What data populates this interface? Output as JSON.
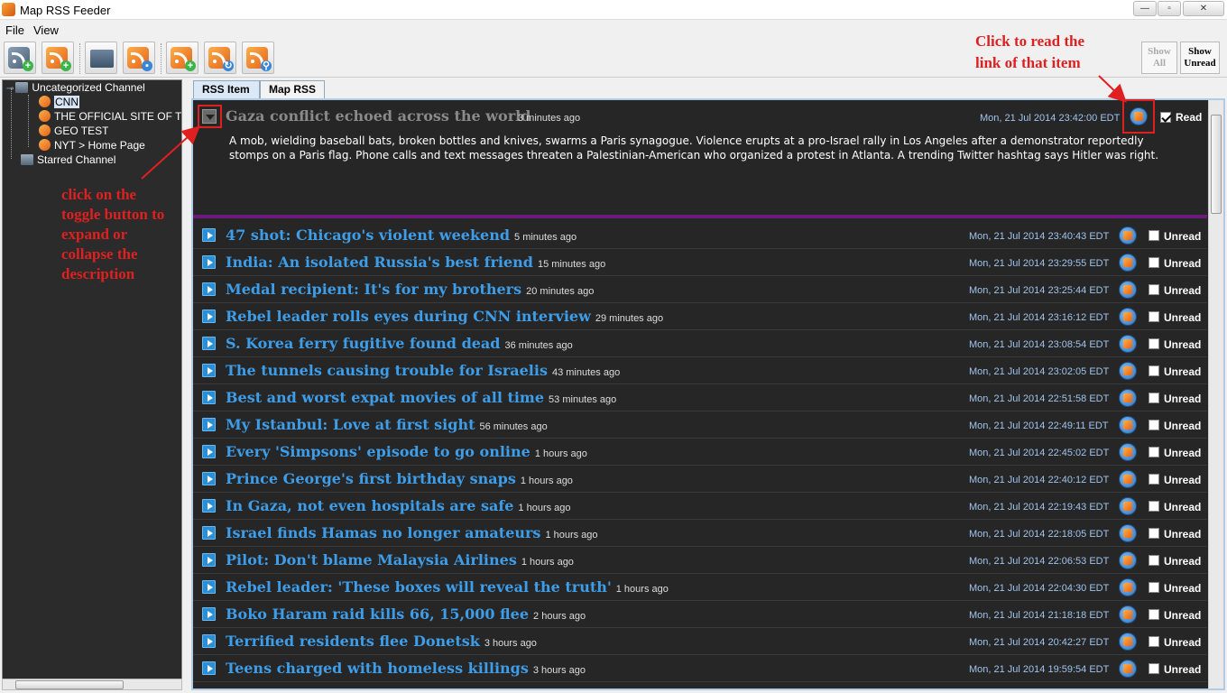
{
  "window": {
    "title": "Map RSS Feeder",
    "minimize": "—",
    "maximize": "▫",
    "close": "✕"
  },
  "menu": [
    "File",
    "View"
  ],
  "toolbar": {
    "show_all_line1": "Show",
    "show_all_line2": "All",
    "show_unread_line1": "Show",
    "show_unread_line2": "Unread"
  },
  "tree": {
    "root": "Uncategorized Channel",
    "items": [
      "CNN",
      "THE OFFICIAL SITE OF T",
      "GEO TEST",
      "NYT > Home Page"
    ],
    "starred": "Starred Channel"
  },
  "tabs": [
    "RSS Item",
    "Map RSS"
  ],
  "expanded": {
    "title": "Gaza conflict echoed across the world",
    "ago": "3 minutes ago",
    "date": "Mon, 21 Jul 2014 23:42:00 EDT",
    "read_label": "Read",
    "description": "A mob, wielding baseball bats, broken bottles and knives, swarms a Paris synagogue. Violence erupts at a pro-Israel rally in Los Angeles after a demonstrator reportedly stomps on a Paris flag. Phone calls and text messages threaten a Palestinian-American who organized a protest in Atlanta. A trending Twitter hashtag says Hitler was right."
  },
  "items": [
    {
      "title": "47 shot: Chicago's violent weekend",
      "ago": "5 minutes ago",
      "date": "Mon, 21 Jul 2014 23:40:43 EDT",
      "status": "Unread"
    },
    {
      "title": "India: An isolated Russia's best friend",
      "ago": "15 minutes ago",
      "date": "Mon, 21 Jul 2014 23:29:55 EDT",
      "status": "Unread"
    },
    {
      "title": "Medal recipient: It's for my brothers",
      "ago": "20 minutes ago",
      "date": "Mon, 21 Jul 2014 23:25:44 EDT",
      "status": "Unread"
    },
    {
      "title": "Rebel leader rolls eyes during CNN interview",
      "ago": "29 minutes ago",
      "date": "Mon, 21 Jul 2014 23:16:12 EDT",
      "status": "Unread"
    },
    {
      "title": "S. Korea ferry fugitive found dead",
      "ago": "36 minutes ago",
      "date": "Mon, 21 Jul 2014 23:08:54 EDT",
      "status": "Unread"
    },
    {
      "title": "The tunnels causing trouble for Israelis",
      "ago": "43 minutes ago",
      "date": "Mon, 21 Jul 2014 23:02:05 EDT",
      "status": "Unread"
    },
    {
      "title": "Best and worst expat movies of all time",
      "ago": "53 minutes ago",
      "date": "Mon, 21 Jul 2014 22:51:58 EDT",
      "status": "Unread"
    },
    {
      "title": "My Istanbul: Love at first sight",
      "ago": "56 minutes ago",
      "date": "Mon, 21 Jul 2014 22:49:11 EDT",
      "status": "Unread"
    },
    {
      "title": "Every 'Simpsons' episode to go online",
      "ago": "1 hours ago",
      "date": "Mon, 21 Jul 2014 22:45:02 EDT",
      "status": "Unread"
    },
    {
      "title": "Prince George's first birthday snaps",
      "ago": "1 hours ago",
      "date": "Mon, 21 Jul 2014 22:40:12 EDT",
      "status": "Unread"
    },
    {
      "title": "In Gaza, not even hospitals are safe",
      "ago": "1 hours ago",
      "date": "Mon, 21 Jul 2014 22:19:43 EDT",
      "status": "Unread"
    },
    {
      "title": "Israel finds Hamas no longer amateurs",
      "ago": "1 hours ago",
      "date": "Mon, 21 Jul 2014 22:18:05 EDT",
      "status": "Unread"
    },
    {
      "title": "Pilot: Don't blame Malaysia Airlines",
      "ago": "1 hours ago",
      "date": "Mon, 21 Jul 2014 22:06:53 EDT",
      "status": "Unread"
    },
    {
      "title": "Rebel leader: 'These boxes will reveal the truth'",
      "ago": "1 hours ago",
      "date": "Mon, 21 Jul 2014 22:04:30 EDT",
      "status": "Unread"
    },
    {
      "title": "Boko Haram raid kills 66, 15,000 flee",
      "ago": "2 hours ago",
      "date": "Mon, 21 Jul 2014 21:18:18 EDT",
      "status": "Unread"
    },
    {
      "title": "Terrified residents flee Donetsk",
      "ago": "3 hours ago",
      "date": "Mon, 21 Jul 2014 20:42:27 EDT",
      "status": "Unread"
    },
    {
      "title": "Teens charged with homeless killings",
      "ago": "3 hours ago",
      "date": "Mon, 21 Jul 2014 19:59:54 EDT",
      "status": "Unread"
    }
  ],
  "annotations": {
    "link_line1": "Click to read the",
    "link_line2": "link of that item",
    "toggle_lines": [
      "click on the",
      "toggle button to",
      "expand or",
      "collapse the",
      "description"
    ]
  },
  "colors": {
    "accent_red": "#e02020",
    "item_blue": "#3e9de8",
    "panel_bg": "#262626",
    "divider_purple": "#6a1a79"
  }
}
